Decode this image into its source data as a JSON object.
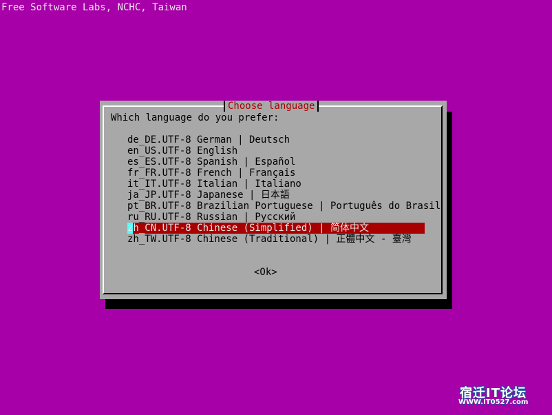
{
  "backtitle": "Free Software Labs, NCHC, Taiwan",
  "dialog": {
    "title": "Choose language",
    "prompt": "Which language do you prefer:",
    "items": [
      {
        "code": "de_DE.UTF-8",
        "label": "de_DE.UTF-8 German | Deutsch",
        "selected": false
      },
      {
        "code": "en_US.UTF-8",
        "label": "en_US.UTF-8 English",
        "selected": false
      },
      {
        "code": "es_ES.UTF-8",
        "label": "es_ES.UTF-8 Spanish | Español",
        "selected": false
      },
      {
        "code": "fr_FR.UTF-8",
        "label": "fr_FR.UTF-8 French | Français",
        "selected": false
      },
      {
        "code": "it_IT.UTF-8",
        "label": "it_IT.UTF-8 Italian | Italiano",
        "selected": false
      },
      {
        "code": "ja_JP.UTF-8",
        "label": "ja_JP.UTF-8 Japanese | 日本語",
        "selected": false
      },
      {
        "code": "pt_BR.UTF-8",
        "label": "pt_BR.UTF-8 Brazilian Portuguese | Português do Brasil",
        "selected": false
      },
      {
        "code": "ru_RU.UTF-8",
        "label": "ru_RU.UTF-8 Russian | Русский",
        "selected": false
      },
      {
        "code": "zh_CN.UTF-8",
        "label": "zh_CN.UTF-8 Chinese (Simplified) | 简体中文",
        "selected": true
      },
      {
        "code": "zh_TW.UTF-8",
        "label": "zh_TW.UTF-8 Chinese (Traditional) | 正體中文 - 臺灣",
        "selected": false
      }
    ],
    "ok_label": "<Ok>"
  },
  "watermark": {
    "title": "宿迁IT论坛",
    "url": "WWW.IT0527.com"
  },
  "colors": {
    "background": "#a800a8",
    "dialog": "#a8a8a8",
    "title_text": "#a80000",
    "selection": "#a80000",
    "cursor": "#54fcfc"
  }
}
